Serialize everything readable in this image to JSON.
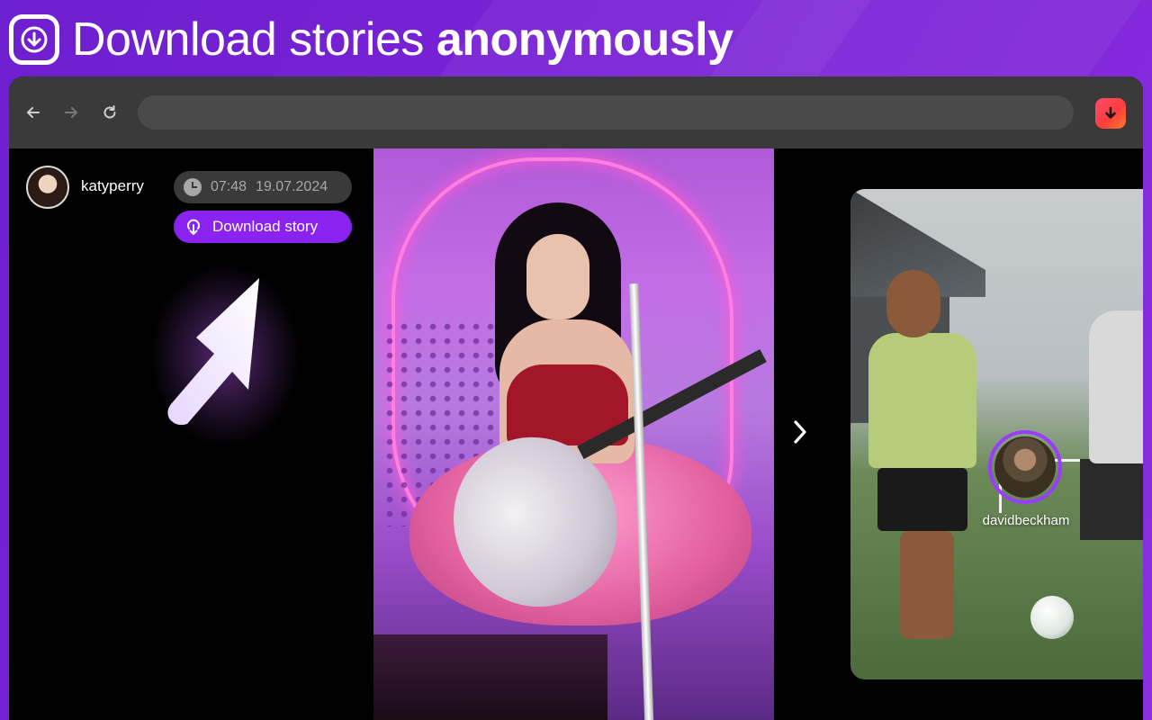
{
  "headline": {
    "text_regular": "Download stories",
    "text_bold": "anonymously"
  },
  "browser": {
    "address_value": "",
    "extension_icon": "download-icon"
  },
  "story": {
    "username": "katyperry",
    "time": "07:48",
    "date": "19.07.2024",
    "download_label": "Download story",
    "clock_icon": "clock-icon"
  },
  "next_story": {
    "username": "davidbeckham"
  },
  "colors": {
    "accent": "#8a22f0",
    "background": "#7a22d6",
    "extension_gradient_start": "#ff4b6e",
    "extension_gradient_end": "#ff7a2f"
  }
}
